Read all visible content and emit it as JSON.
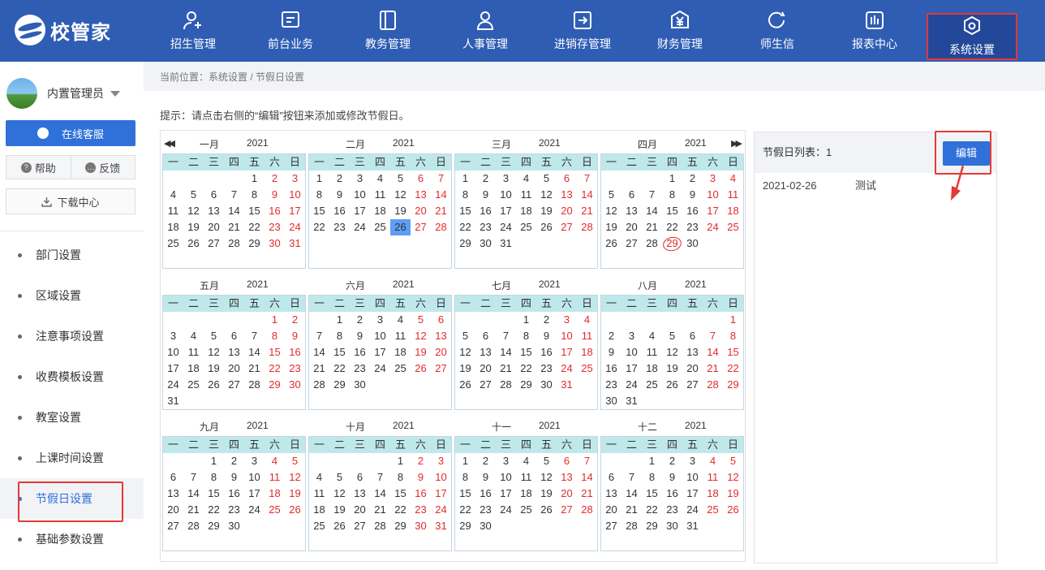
{
  "brand": {
    "name": "校管家"
  },
  "nav": [
    {
      "label": "招生管理",
      "icon": "user-add-icon"
    },
    {
      "label": "前台业务",
      "icon": "monitor-icon"
    },
    {
      "label": "教务管理",
      "icon": "book-icon"
    },
    {
      "label": "人事管理",
      "icon": "person-icon"
    },
    {
      "label": "进销存管理",
      "icon": "login-arrow-icon"
    },
    {
      "label": "财务管理",
      "icon": "yuan-icon"
    },
    {
      "label": "师生信",
      "icon": "chat-icon"
    },
    {
      "label": "报表中心",
      "icon": "chart-icon"
    },
    {
      "label": "系统设置",
      "icon": "settings-icon",
      "active": true
    }
  ],
  "sidebar": {
    "user_name": "内置管理员",
    "service_label": "在线客服",
    "help_label": "帮助",
    "feedback_label": "反馈",
    "download_label": "下载中心",
    "menu": [
      {
        "label": "部门设置"
      },
      {
        "label": "区域设置"
      },
      {
        "label": "注意事项设置"
      },
      {
        "label": "收费模板设置"
      },
      {
        "label": "教室设置"
      },
      {
        "label": "上课时间设置"
      },
      {
        "label": "节假日设置",
        "active": true
      },
      {
        "label": "基础参数设置"
      }
    ]
  },
  "breadcrumb": "当前位置：系统设置 / 节假日设置",
  "hint": "提示：请点击右侧的“编辑”按钮来添加或修改节假日。",
  "calendar": {
    "year": "2021",
    "weekdays": [
      "一",
      "二",
      "三",
      "四",
      "五",
      "六",
      "日"
    ],
    "months": [
      {
        "name": "一月",
        "offset": 4,
        "days": 31
      },
      {
        "name": "二月",
        "offset": 0,
        "days": 28
      },
      {
        "name": "三月",
        "offset": 0,
        "days": 31
      },
      {
        "name": "四月",
        "offset": 3,
        "days": 30
      },
      {
        "name": "五月",
        "offset": 5,
        "days": 31
      },
      {
        "name": "六月",
        "offset": 1,
        "days": 30
      },
      {
        "name": "七月",
        "offset": 3,
        "days": 31
      },
      {
        "name": "八月",
        "offset": 6,
        "days": 31
      },
      {
        "name": "九月",
        "offset": 2,
        "days": 30
      },
      {
        "name": "十月",
        "offset": 4,
        "days": 31
      },
      {
        "name": "十一",
        "offset": 0,
        "days": 30
      },
      {
        "name": "十二",
        "offset": 2,
        "days": 31
      }
    ],
    "highlight": {
      "month": 2,
      "day": 26
    },
    "circled": {
      "month": 4,
      "day": 29
    },
    "colors": {
      "weekend": "#e32b2b",
      "highlight": "#5e9df5",
      "header": "#bfe8ea"
    }
  },
  "panel": {
    "title": "节假日列表：1",
    "edit_label": "编辑",
    "holidays": [
      {
        "date": "2021-02-26",
        "name": "测试"
      }
    ]
  },
  "colors": {
    "topbar": "#2f5db4",
    "accent": "#2f71d9",
    "annotation": "#e53935"
  }
}
